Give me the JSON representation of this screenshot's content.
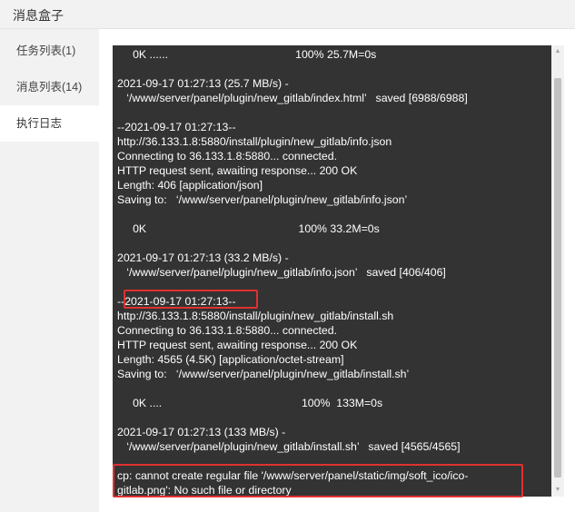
{
  "window": {
    "title": "消息盒子"
  },
  "sidebar": {
    "items": [
      {
        "label": "任务列表(1)",
        "active": false
      },
      {
        "label": "消息列表(14)",
        "active": false
      },
      {
        "label": "执行日志",
        "active": true
      }
    ]
  },
  "log": {
    "lines": [
      "     0K ......                                         100% 25.7M=0s",
      "",
      "2021-09-17 01:27:13 (25.7 MB/s) -",
      "   ‘/www/server/panel/plugin/new_gitlab/index.html’   saved [6988/6988]",
      "",
      "--2021-09-17 01:27:13--",
      "http://36.133.1.8:5880/install/plugin/new_gitlab/info.json",
      "Connecting to 36.133.1.8:5880... connected.",
      "HTTP request sent, awaiting response... 200 OK",
      "Length: 406 [application/json]",
      "Saving to:   ‘/www/server/panel/plugin/new_gitlab/info.json’",
      "",
      "     0K                                                 100% 33.2M=0s",
      "",
      "2021-09-17 01:27:13 (33.2 MB/s) -",
      "   ‘/www/server/panel/plugin/new_gitlab/info.json’   saved [406/406]",
      "",
      "--2021-09-17 01:27:13--",
      "http://36.133.1.8:5880/install/plugin/new_gitlab/install.sh",
      "Connecting to 36.133.1.8:5880... connected.",
      "HTTP request sent, awaiting response... 200 OK",
      "Length: 4565 (4.5K) [application/octet-stream]",
      "Saving to:   ‘/www/server/panel/plugin/new_gitlab/install.sh’",
      "",
      "     0K ....                                             100%  133M=0s",
      "",
      "2021-09-17 01:27:13 (133 MB/s) -",
      "   ‘/www/server/panel/plugin/new_gitlab/install.sh’   saved [4565/4565]",
      "",
      "cp: cannot create regular file '/www/server/panel/static/img/soft_ico/ico-",
      "gitlab.png': No such file or directory"
    ]
  },
  "highlight": {
    "color": "#e03030"
  }
}
